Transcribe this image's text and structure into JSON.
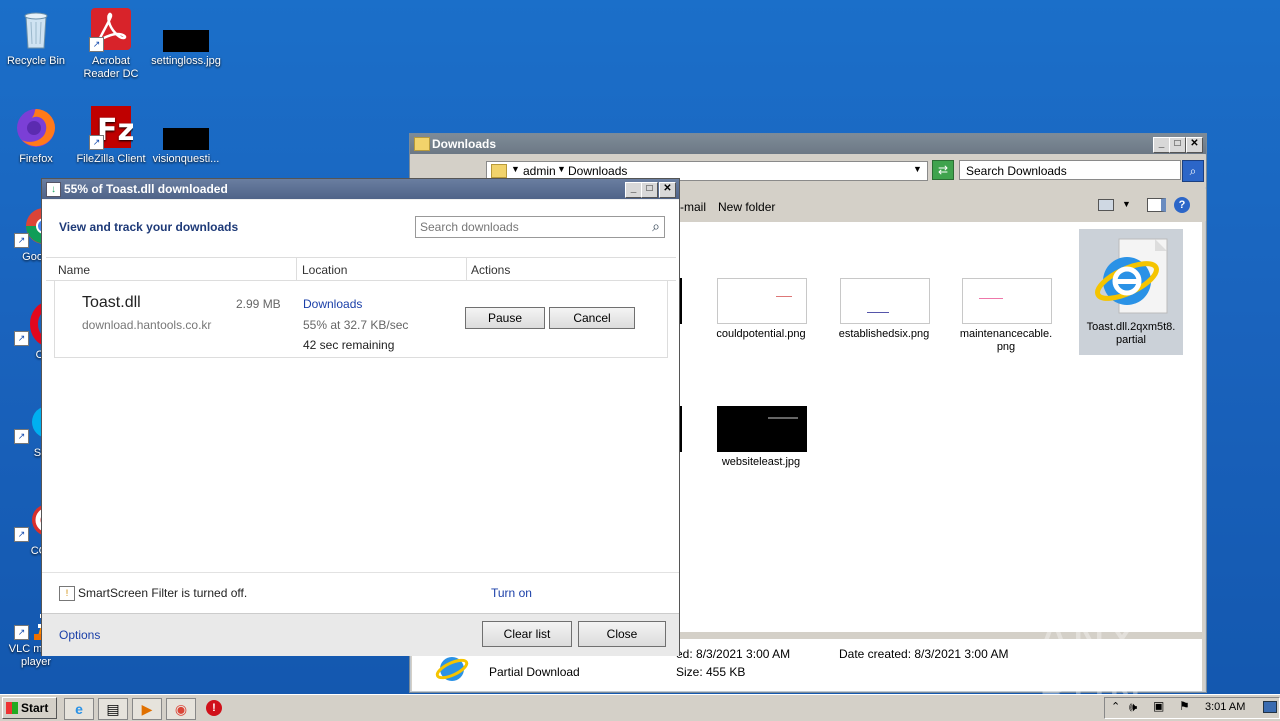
{
  "desktop": {
    "icons": [
      {
        "label": "Recycle Bin"
      },
      {
        "label": "Acrobat Reader DC"
      },
      {
        "label": "settingloss.jpg"
      },
      {
        "label": "Firefox"
      },
      {
        "label": "FileZilla Client"
      },
      {
        "label": "visionquesti..."
      },
      {
        "label": "Goo Chro"
      },
      {
        "label": "Ope"
      },
      {
        "label": "Skyp"
      },
      {
        "label": "CClea"
      },
      {
        "label": "VLC media player"
      }
    ]
  },
  "explorer": {
    "title": "Downloads",
    "breadcrumb": [
      "admin",
      "Downloads"
    ],
    "search_placeholder": "Search Downloads",
    "toolbar": {
      "email": "-mail",
      "new_folder": "New folder"
    },
    "files": [
      {
        "name": "couldpotential.png"
      },
      {
        "name": "establishedsix.png"
      },
      {
        "name": "maintenancecable.\npng"
      },
      {
        "name": "Toast.dll.2qxm5t8.\npartial"
      },
      {
        "name": "websiteleast.jpg"
      }
    ],
    "details": {
      "type": "Partial Download",
      "modified": "ed: 8/3/2021 3:00 AM",
      "created": "Date created: 8/3/2021 3:00 AM",
      "size": "Size: 455 KB"
    }
  },
  "download_dialog": {
    "title": "55% of Toast.dll downloaded",
    "heading": "View and track your downloads",
    "search_placeholder": "Search downloads",
    "columns": {
      "name": "Name",
      "location": "Location",
      "actions": "Actions"
    },
    "item": {
      "filename": "Toast.dll",
      "size": "2.99 MB",
      "source": "download.hantools.co.kr",
      "location_link": "Downloads",
      "progress_text": "55% at 32.7 KB/sec",
      "remaining": "42 sec remaining",
      "pause_label": "Pause",
      "cancel_label": "Cancel"
    },
    "smartscreen_text": "SmartScreen Filter is turned off.",
    "turn_on_label": "Turn on",
    "options_label": "Options",
    "clear_list_label": "Clear list",
    "close_label": "Close"
  },
  "taskbar": {
    "start_label": "Start",
    "clock": "3:01 AM"
  },
  "watermark": "ANY RUN",
  "colors": {
    "link": "#1a3fa8",
    "desktop": "#1a63bd"
  }
}
